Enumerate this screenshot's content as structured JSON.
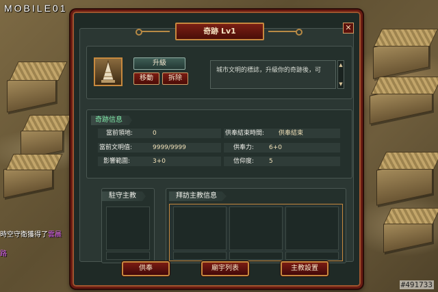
{
  "overlay": {
    "logo": "MOBILE01",
    "watermark": "#491733"
  },
  "chat": {
    "line1_text": "時空守衛獲得了",
    "line1_highlight": "雲晨",
    "line2_text": "路"
  },
  "dialog": {
    "title": "奇跡 Lv1",
    "close_label": "✕",
    "buttons": {
      "upgrade": "升級",
      "move": "移動",
      "demolish": "拆除"
    },
    "description": "城市文明的標誌，升級你的奇跡後，可",
    "info": {
      "section_title": "奇跡信息",
      "rows": [
        {
          "label": "當前領地:",
          "value": "0"
        },
        {
          "label": "當前文明值:",
          "value": "9999/9999"
        },
        {
          "label": "影響範圍:",
          "value": "3+0"
        }
      ],
      "rows_right": [
        {
          "label": "供奉結束時間:",
          "value": "供奉結束"
        },
        {
          "label": "供奉力:",
          "value": "6+0"
        },
        {
          "label": "信仰度:",
          "value": "5"
        }
      ]
    },
    "garrison_title": "駐守主教",
    "visit_title": "拜訪主教信息",
    "bottom_buttons": {
      "worship": "供奉",
      "pantheon": "廟宇列表",
      "bishop_settings": "主教設置"
    }
  }
}
